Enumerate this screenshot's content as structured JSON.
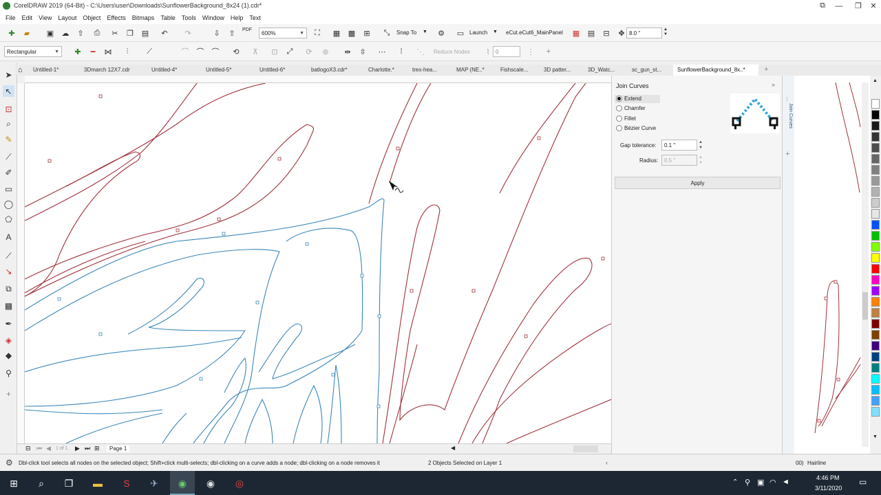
{
  "window": {
    "title": "CorelDRAW 2019 (64-Bit) - C:\\Users\\user\\Downloads\\SunflowerBackground_8x24 (1).cdr*",
    "controls": [
      "⧉",
      "—",
      "❐",
      "✕"
    ]
  },
  "menu": [
    "File",
    "Edit",
    "View",
    "Layout",
    "Object",
    "Effects",
    "Bitmaps",
    "Table",
    "Tools",
    "Window",
    "Help",
    "Text"
  ],
  "toolbar": {
    "zoom": "600%",
    "snap_to": "Snap To",
    "launch": "Launch",
    "ecut": "eCut.eCut6_MainPanel",
    "nudge": "8.0 \"",
    "pdf": "PDF"
  },
  "property_bar": {
    "mode": "Rectangular",
    "reduce_nodes": "Reduce Nodes",
    "smoothness": "0"
  },
  "tabs": [
    {
      "label": "Untitled-1*"
    },
    {
      "label": "3Dmarch 12X7.cdr"
    },
    {
      "label": "Untitled-4*"
    },
    {
      "label": "Untitled-5*"
    },
    {
      "label": "Untitled-6*"
    },
    {
      "label": "batlogoX3.cdr*"
    },
    {
      "label": "Charlotte.*"
    },
    {
      "label": "trex-hea..."
    },
    {
      "label": "MAP (NE..*"
    },
    {
      "label": "Fishscale..."
    },
    {
      "label": "3D patter..."
    },
    {
      "label": "3D_Watc..."
    },
    {
      "label": "sc_gun_st..."
    },
    {
      "label": "SunflowerBackground_8x..*"
    }
  ],
  "page_nav": {
    "counter": "1 of 1",
    "page": "Page 1"
  },
  "docker": {
    "title": "Join Curves",
    "side_tab": "Join Curves",
    "options": [
      "Extend",
      "Chamfer",
      "Fillet",
      "Bézier Curve"
    ],
    "selected": "Extend",
    "gap_label": "Gap tolerance:",
    "gap_value": "0.1 \"",
    "radius_label": "Radius:",
    "radius_value": "0.5 \"",
    "apply": "Apply"
  },
  "status": {
    "hint": "Dbl-click tool selects all nodes on the selected object; Shift+click multi-selects; dbl-clicking on a curve adds a node; dbl-clicking on a node removes it",
    "selection": "2 Objects Selected on Layer 1",
    "outline_partial": "00)",
    "outline": "Hairline"
  },
  "taskbar": {
    "time": "4:46 PM",
    "date": "3/11/2020"
  },
  "colors": {
    "red_curve": "#a0303a",
    "blue_curve": "#3a86b8",
    "docker_bg": "#f5f5f5",
    "taskbar": "#1c2733",
    "active_tab": "#ffffff"
  },
  "palette": [
    "#ffffff",
    "#000000",
    "#1a1a1a",
    "#333333",
    "#4d4d4d",
    "#666666",
    "#808080",
    "#999999",
    "#b3b3b3",
    "#cccccc",
    "#e6e6e6",
    "#ffffff",
    "#0050ff",
    "#00c000",
    "#80ff00",
    "#ffff00",
    "#ff0000",
    "#ff00c0",
    "#a000ff",
    "#ff8000",
    "#c08040",
    "#800000",
    "#804000",
    "#400080",
    "#004080",
    "#008080",
    "#00ffff",
    "#00c0ff",
    "#40a0ff",
    "#80e0ff"
  ]
}
